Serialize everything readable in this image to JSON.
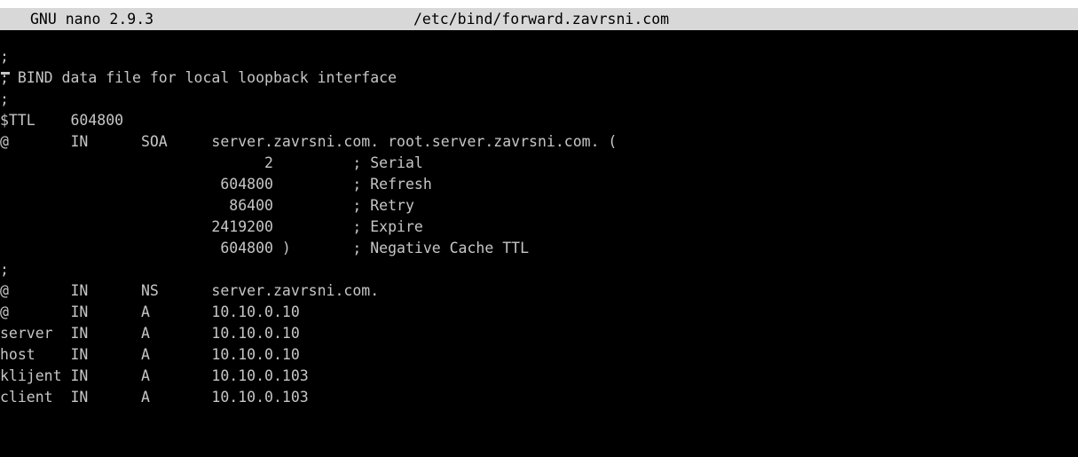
{
  "titlebar": {
    "app": "GNU nano 2.9.3",
    "file": "/etc/bind/forward.zavrsni.com"
  },
  "colors": {
    "background": "#000000",
    "text": "#c6c6c6",
    "titlebar_bg": "#d8d8d8",
    "titlebar_text": "#000000"
  },
  "buffer": {
    "lines": [
      ";",
      "; BIND data file for local loopback interface",
      ";",
      "$TTL    604800",
      "@       IN      SOA     server.zavrsni.com. root.server.zavrsni.com. (",
      "                              2         ; Serial",
      "                         604800         ; Refresh",
      "                          86400         ; Retry",
      "                        2419200         ; Expire",
      "                         604800 )       ; Negative Cache TTL",
      ";",
      "@       IN      NS      server.zavrsni.com.",
      "@       IN      A       10.10.0.10",
      "server  IN      A       10.10.0.10",
      "host    IN      A       10.10.0.10",
      "klijent IN      A       10.10.0.103",
      "client  IN      A       10.10.0.103"
    ]
  }
}
